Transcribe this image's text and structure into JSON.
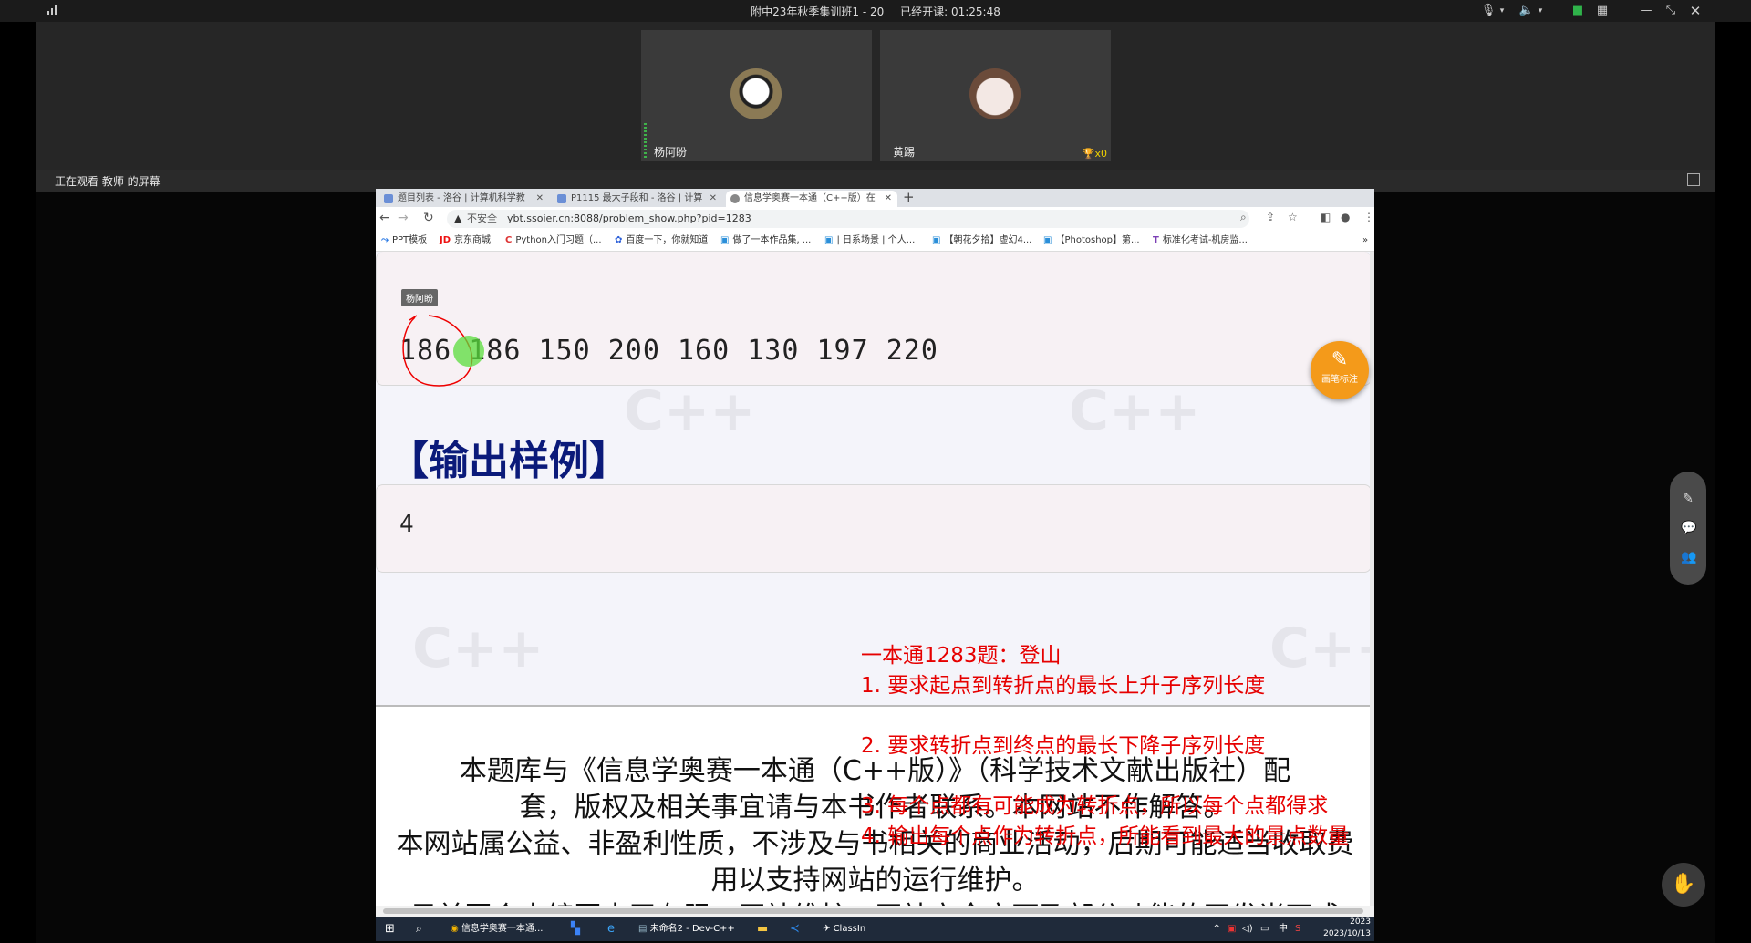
{
  "classin": {
    "class_name": "附中23年秋季集训班1 - 20",
    "elapsed_label": "已经开课: 01:25:48",
    "share_label": "正在观看 教师 的屏幕",
    "participants": [
      {
        "name": "杨阿盼"
      },
      {
        "name": "黄踢",
        "trophy": "x0"
      }
    ],
    "brush_label": "画笔标注"
  },
  "browser": {
    "tabs": [
      {
        "label": "题目列表 - 洛谷 | 计算机科学教"
      },
      {
        "label": "P1115 最大子段和 - 洛谷 | 计算"
      },
      {
        "label": "信息学奥赛一本通（C++版）在"
      }
    ],
    "insecure_label": "不安全",
    "url": "ybt.ssoier.cn:8088/problem_show.php?pid=1283",
    "bookmarks": [
      "PPT模板",
      "京东商城",
      "Python入门习题（...",
      "百度一下，你就知道",
      "做了一本作品集, ...",
      "| 日系场景 | 个人...",
      "【朝花夕拾】虚幻4...",
      "【Photoshop】第...",
      "标准化考试-机房监..."
    ]
  },
  "problem": {
    "pointer_name": "杨阿盼",
    "input_sample": "186 186 150 200 160 130 197 220",
    "output_heading": "【输出样例】",
    "output_sample": "4",
    "watermark": "C++",
    "copyright_lines": [
      "本题库与《信息学奥赛一本通（C++版）》（科学技术文献出版社）配",
      "套，版权及相关事宜请与本书作者联系。本网站不作解答。",
      "本网站属公益、非盈利性质，不涉及与书相关的商业活动，后期可能适当收取费",
      "用以支持网站的运行维护。",
      "目前因个人编写水平有限，网站维护、网站安全方面及部分功能的开发尚不成"
    ]
  },
  "annotation": {
    "title": "一本通1283题：登山",
    "line1": "1. 要求起点到转折点的最长上升子序列长度",
    "line2": "2. 要求转折点到终点的最长下降子序列长度",
    "line3": "3. 每个点都有可能成为转折点，所以每个点都得求",
    "line4": "4. 输出每个点作为转折点，所能看到最大的景点数量"
  },
  "taskbar": {
    "chrome_label": "信息学奥赛一本通...",
    "devcpp_label": "未命名2 - Dev-C++",
    "classin_label": "ClassIn",
    "time": "2023",
    "date": "2023/10/13",
    "ime": "中"
  }
}
